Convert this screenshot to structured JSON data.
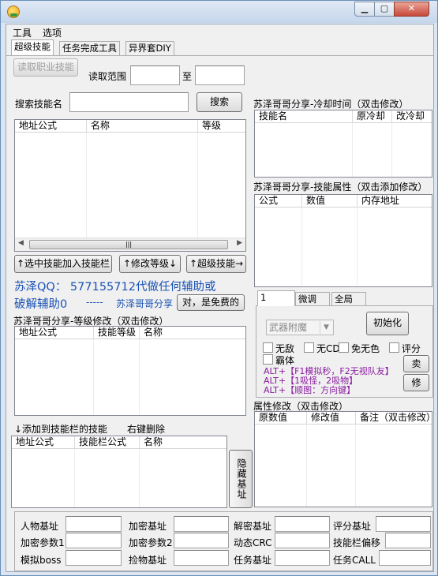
{
  "menu": [
    "工具",
    "选项"
  ],
  "tabs": [
    "超级技能",
    "任务完成工具",
    "异界套DIY"
  ],
  "left": {
    "read_job_skill": "读取职业技能",
    "read_range_label": "读取范围",
    "to_label": "至",
    "search_label": "搜索技能名",
    "search_button": "搜索",
    "skill_list_headers": [
      "地址公式",
      "名称",
      "等级"
    ],
    "btn_add_to_bar": "↑选中技能加入技能栏",
    "btn_modify_level": "↑修改等级↓",
    "btn_super_skill": "↑超级技能→",
    "promo_line1": "苏泽QQ： 577155712代做任何辅助或",
    "promo_line2": "破解辅助0",
    "promo_dash": "-----",
    "promo_share": "苏泽哥哥分享",
    "btn_free": "对，是免费的",
    "level_modify_title": "苏泽哥哥分享-等级修改（双击修改）",
    "level_list_headers": [
      "地址公式",
      "技能等级",
      "名称"
    ],
    "add_bar_label": "↓添加到技能栏的技能",
    "right_click_delete": "右键删除",
    "bar_list_headers": [
      "地址公式",
      "技能栏公式",
      "名称"
    ],
    "hide_base_button": "隐藏基址"
  },
  "right": {
    "cooldown_title": "苏泽哥哥分享-冷却时间（双击修改）",
    "cooldown_headers": [
      "技能名",
      "原冷却",
      "改冷却"
    ],
    "attr_title": "苏泽哥哥分享-技能属性（双击添加修改）",
    "attr_headers": [
      "公式",
      "数值",
      "内存地址"
    ],
    "subtabs": [
      "1",
      "微调",
      "全局"
    ],
    "weapon_select": "武器附魔",
    "init_button": "初始化",
    "checks": [
      "无敌",
      "无CD",
      "免无色",
      "评分",
      "霸体"
    ],
    "hotkeys": [
      "ALT+【F1模拟秒，F2无视队友】",
      "ALT+【1吸怪，2吸物】",
      "ALT+【顺图：方向键】"
    ],
    "sell_button": "卖",
    "repair_button": "修",
    "prop_title": "属性修改（双击修改）",
    "prop_headers": [
      "原数值",
      "修改值",
      "备注（双击修改）"
    ]
  },
  "bottom": {
    "labels": [
      [
        "人物基址",
        "加密基址",
        "解密基址",
        "评分基址"
      ],
      [
        "加密参数1",
        "加密参数2",
        "动态CRC",
        "技能栏偏移"
      ],
      [
        "模拟boss",
        "捡物基址",
        "任务基址",
        "任务CALL"
      ]
    ]
  }
}
